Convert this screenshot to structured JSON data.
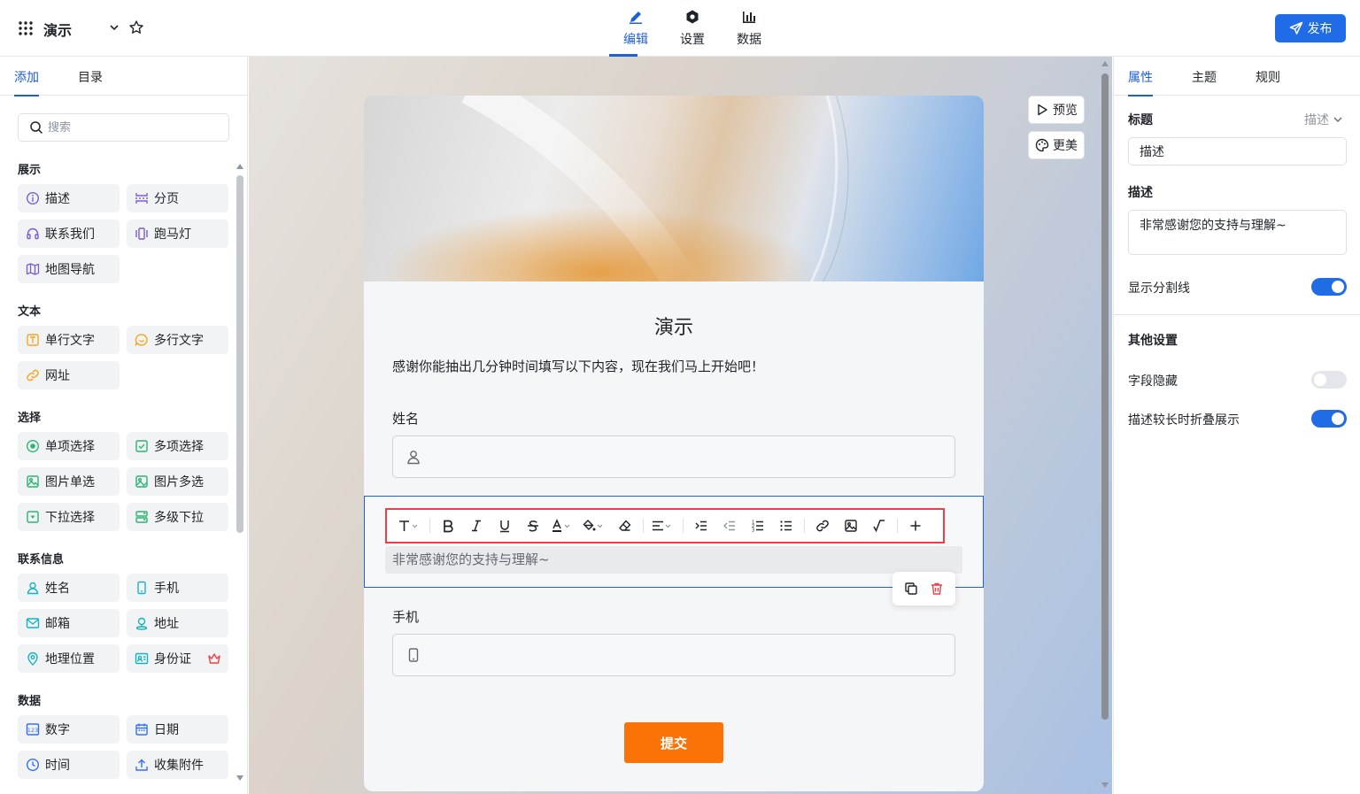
{
  "header": {
    "app_title": "演示",
    "tabs": [
      {
        "label": "编辑",
        "icon": "edit-icon",
        "active": true
      },
      {
        "label": "设置",
        "icon": "settings-icon",
        "active": false
      },
      {
        "label": "数据",
        "icon": "bar-chart-icon",
        "active": false
      }
    ],
    "publish_label": "发布"
  },
  "left_panel": {
    "tabs": [
      "添加",
      "目录"
    ],
    "search_placeholder": "搜索",
    "sections": [
      {
        "title": "展示",
        "items": [
          {
            "label": "描述",
            "icon": "info-circle-icon",
            "color": "#7b5cd6"
          },
          {
            "label": "分页",
            "icon": "page-break-icon",
            "color": "#7b5cd6"
          },
          {
            "label": "联系我们",
            "icon": "headset-icon",
            "color": "#7b5cd6"
          },
          {
            "label": "跑马灯",
            "icon": "carousel-icon",
            "color": "#7b5cd6"
          },
          {
            "label": "地图导航",
            "icon": "map-icon",
            "color": "#7b5cd6"
          }
        ]
      },
      {
        "title": "文本",
        "items": [
          {
            "label": "单行文字",
            "icon": "text-input-icon",
            "color": "#f5a623"
          },
          {
            "label": "多行文字",
            "icon": "chat-bubble-icon",
            "color": "#f5a623"
          },
          {
            "label": "网址",
            "icon": "link-icon",
            "color": "#f5a623"
          }
        ]
      },
      {
        "title": "选择",
        "items": [
          {
            "label": "单项选择",
            "icon": "radio-icon",
            "color": "#2bb673"
          },
          {
            "label": "多项选择",
            "icon": "checkbox-icon",
            "color": "#2bb673"
          },
          {
            "label": "图片单选",
            "icon": "image-icon",
            "color": "#2bb673"
          },
          {
            "label": "图片多选",
            "icon": "image-multi-icon",
            "color": "#2bb673"
          },
          {
            "label": "下拉选择",
            "icon": "dropdown-icon",
            "color": "#2bb673"
          },
          {
            "label": "多级下拉",
            "icon": "cascade-icon",
            "color": "#2bb673"
          }
        ]
      },
      {
        "title": "联系信息",
        "items": [
          {
            "label": "姓名",
            "icon": "user-icon",
            "color": "#17b3c2"
          },
          {
            "label": "手机",
            "icon": "phone-icon",
            "color": "#17b3c2"
          },
          {
            "label": "邮箱",
            "icon": "mail-icon",
            "color": "#17b3c2"
          },
          {
            "label": "地址",
            "icon": "location-person-icon",
            "color": "#17b3c2"
          },
          {
            "label": "地理位置",
            "icon": "location-pin-icon",
            "color": "#17b3c2"
          },
          {
            "label": "身份证",
            "icon": "id-card-icon",
            "color": "#17b3c2",
            "premium": true
          }
        ]
      },
      {
        "title": "数据",
        "items": [
          {
            "label": "数字",
            "icon": "number-icon",
            "color": "#3370ff"
          },
          {
            "label": "日期",
            "icon": "calendar-icon",
            "color": "#3370ff"
          },
          {
            "label": "时间",
            "icon": "clock-icon",
            "color": "#3370ff"
          },
          {
            "label": "收集附件",
            "icon": "upload-icon",
            "color": "#3370ff"
          }
        ]
      }
    ]
  },
  "canvas": {
    "preview_label": "预览",
    "beautify_label": "更美",
    "form_title": "演示",
    "form_description": "感谢你能抽出几分钟时间填写以下内容，现在我们马上开始吧！",
    "fields": [
      {
        "label": "姓名",
        "icon": "user-icon"
      },
      {
        "label": "手机",
        "icon": "phone-icon"
      }
    ],
    "selected_description": "非常感谢您的支持与理解~",
    "submit_label": "提交",
    "toolbar_icons": [
      "text-style-icon",
      "bold-icon",
      "italic-icon",
      "underline-icon",
      "strikethrough-icon",
      "font-color-icon",
      "fill-color-icon",
      "eraser-icon",
      "align-icon",
      "indent-icon",
      "outdent-icon",
      "ordered-list-icon",
      "bullet-list-icon",
      "link-icon",
      "image-icon",
      "formula-icon",
      "plus-icon"
    ]
  },
  "right_panel": {
    "tabs": [
      "属性",
      "主题",
      "规则"
    ],
    "title_label": "标题",
    "title_type": "描述",
    "title_value": "描述",
    "desc_label": "描述",
    "desc_value": "非常感谢您的支持与理解~",
    "show_divider_label": "显示分割线",
    "show_divider": true,
    "other_settings_label": "其他设置",
    "hide_field_label": "字段隐藏",
    "hide_field": false,
    "collapse_label": "描述较长时折叠展示",
    "collapse": true
  },
  "colors": {
    "accent": "#1f6ce6",
    "submit": "#fb7206",
    "toolbar_highlight": "#e8414a",
    "premium": "#e8414a"
  }
}
